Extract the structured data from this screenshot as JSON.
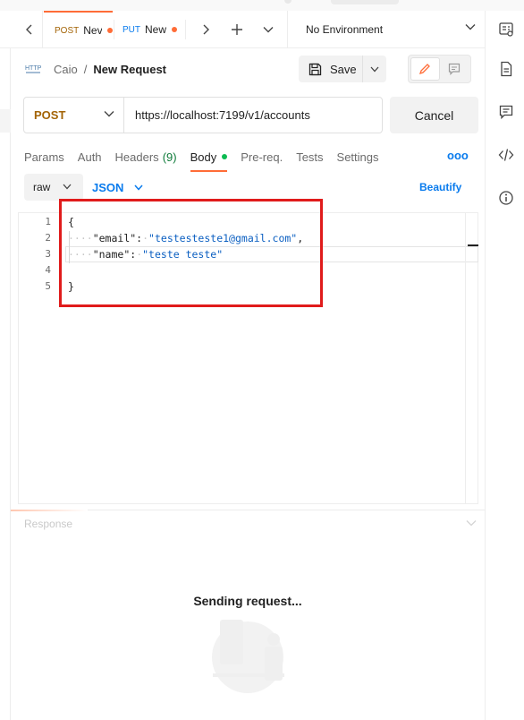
{
  "tabs": [
    {
      "method": "POST",
      "label": "Nev",
      "method_color": "#a36406",
      "unsaved": true,
      "active": true
    },
    {
      "method": "PUT",
      "label": "New",
      "method_color": "#097bed",
      "unsaved": true,
      "active": false
    }
  ],
  "environment": {
    "selected": "No Environment"
  },
  "breadcrumb": {
    "parent": "Caio",
    "separator": "/",
    "current": "New Request"
  },
  "actions": {
    "save_label": "Save",
    "cancel_label": "Cancel"
  },
  "request": {
    "method": "POST",
    "url": "https://localhost:7199/v1/accounts"
  },
  "request_tabs": [
    {
      "label": "Params"
    },
    {
      "label": "Auth"
    },
    {
      "label": "Headers",
      "count": "(9)"
    },
    {
      "label": "Body",
      "active": true,
      "indicator": true
    },
    {
      "label": "Pre-req."
    },
    {
      "label": "Tests"
    },
    {
      "label": "Settings"
    }
  ],
  "more_label": "ooo",
  "body": {
    "mode": "raw",
    "language": "JSON",
    "beautify_label": "Beautify",
    "lines": [
      {
        "n": "1",
        "text": "{"
      },
      {
        "n": "2",
        "key": "\"email\"",
        "value": "\"testesteste1@gmail.com\"",
        "trail": ","
      },
      {
        "n": "3",
        "key": "\"name\"",
        "value": "\"teste teste\"",
        "trail": ""
      },
      {
        "n": "4",
        "text": ""
      },
      {
        "n": "5",
        "text": "}"
      }
    ]
  },
  "response": {
    "label": "Response",
    "status_text": "Sending request..."
  },
  "colors": {
    "accent": "#ff6c37",
    "link": "#097bed",
    "method_post": "#a36406",
    "highlight": "#e01b1b"
  },
  "icons": [
    "chevron-left-icon",
    "chevron-right-icon",
    "plus-icon",
    "chevron-down-icon",
    "environment-quick-look-icon",
    "http-icon",
    "save-icon",
    "pencil-icon",
    "comment-icon",
    "documentation-icon",
    "comments-icon",
    "code-icon",
    "info-icon"
  ]
}
